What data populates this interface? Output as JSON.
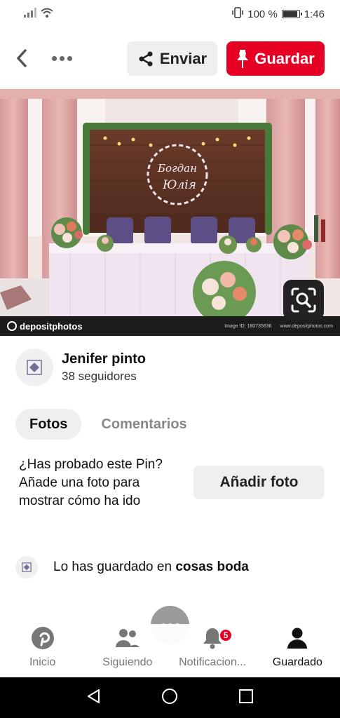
{
  "status_bar": {
    "battery": "100 %",
    "time": "1:46"
  },
  "toolbar": {
    "send_label": "Enviar",
    "save_label": "Guardar"
  },
  "image": {
    "sign_text_1": "Богдан",
    "sign_text_2": "Юлія",
    "watermark_brand": "depositphotos",
    "watermark_id": "Image ID: 180735636",
    "watermark_url": "www.depositphotos.com"
  },
  "author": {
    "name": "Jenifer pinto",
    "followers": "38 seguidores"
  },
  "tabs": [
    {
      "label": "Fotos",
      "active": true
    },
    {
      "label": "Comentarios",
      "active": false
    }
  ],
  "try_pin": {
    "text": "¿Has probado este Pin? Añade una foto para mostrar cómo ha ido",
    "button": "Añadir foto"
  },
  "saved": {
    "prefix": "Lo has guardado en",
    "board": "cosas boda"
  },
  "bottom_nav": {
    "items": [
      {
        "label": "Inicio",
        "icon": "pinterest-icon"
      },
      {
        "label": "Siguiendo",
        "icon": "people-icon"
      },
      {
        "label": "Notificacion...",
        "icon": "bell-icon",
        "badge": "5"
      },
      {
        "label": "Guardado",
        "icon": "profile-icon"
      }
    ]
  },
  "colors": {
    "brand_red": "#e60023",
    "button_gray": "#efefef"
  }
}
